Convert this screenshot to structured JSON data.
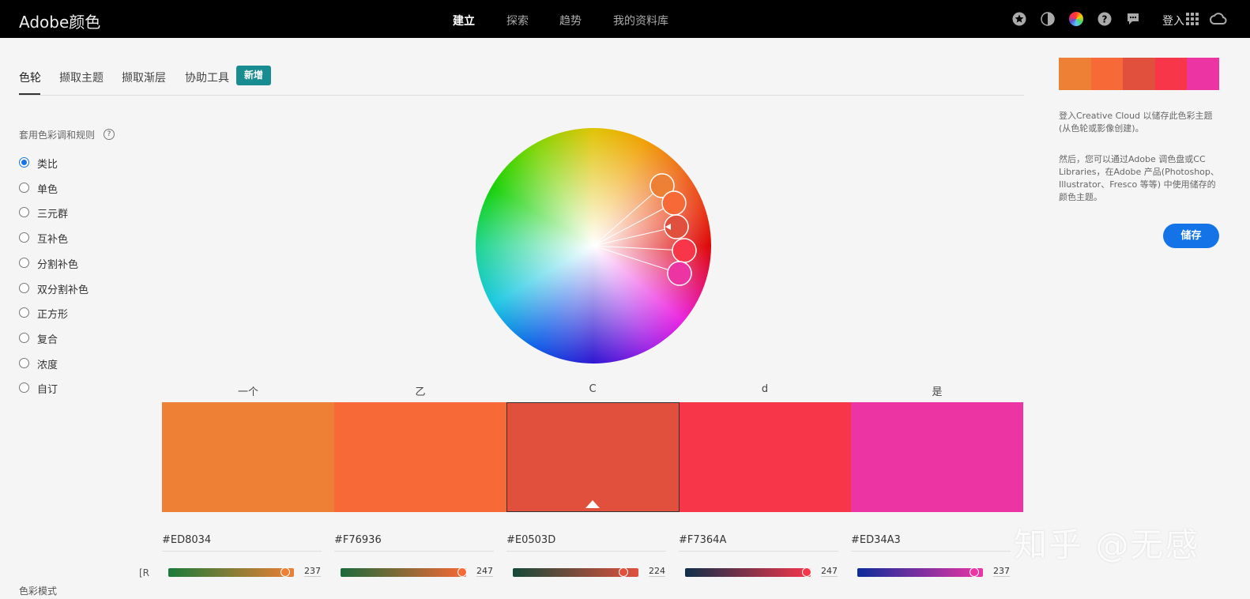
{
  "header": {
    "logo": "Adobe颜色",
    "nav": [
      "建立",
      "探索",
      "趋势",
      "我的资料库"
    ],
    "login": "登入",
    "icons": [
      "star-icon",
      "contrast-icon",
      "color-wheel-icon",
      "help-icon",
      "chat-icon",
      "apps-grid-icon",
      "creative-cloud-icon"
    ]
  },
  "tabs": {
    "items": [
      "色轮",
      "撷取主题",
      "撷取渐层",
      "协助工具"
    ],
    "new_badge": "新增"
  },
  "rules": {
    "title": "套用色彩调和规则",
    "help": "?",
    "items": [
      "类比",
      "单色",
      "三元群",
      "互补色",
      "分割补色",
      "双分割补色",
      "正方形",
      "复合",
      "浓度",
      "自订"
    ],
    "selected": "类比"
  },
  "swatches": [
    {
      "label": "一个",
      "hex": "#ED8034",
      "r": "237",
      "grad": [
        "#1a7a3a",
        "#ED8034"
      ],
      "knob": 0.93
    },
    {
      "label": "乙",
      "hex": "#F76936",
      "r": "247",
      "grad": [
        "#1a6a3a",
        "#F76936"
      ],
      "knob": 0.97
    },
    {
      "label": "C",
      "hex": "#E0503D",
      "r": "224",
      "grad": [
        "#14493a",
        "#E0503D"
      ],
      "knob": 0.88
    },
    {
      "label": "d",
      "hex": "#F7364A",
      "r": "247",
      "grad": [
        "#0e2f4a",
        "#F7364A"
      ],
      "knob": 0.97
    },
    {
      "label": "是",
      "hex": "#ED34A3",
      "r": "237",
      "grad": [
        "#0c2c9c",
        "#ED34A3"
      ],
      "knob": 0.93
    }
  ],
  "selected_swatch": "C",
  "channel_label": "[R",
  "mode_label": "色彩模式",
  "right_panel": {
    "text1": "登入Creative Cloud 以储存此色彩主题 (从色轮或影像创建)。",
    "text2": "然后，您可以通过Adobe 调色盘或CC Libraries，在Adobe 产品(Photoshop、Illustrator、Fresco 等等) 中使用储存的颜色主题。",
    "save": "储存"
  },
  "watermark": "知乎 @无感"
}
